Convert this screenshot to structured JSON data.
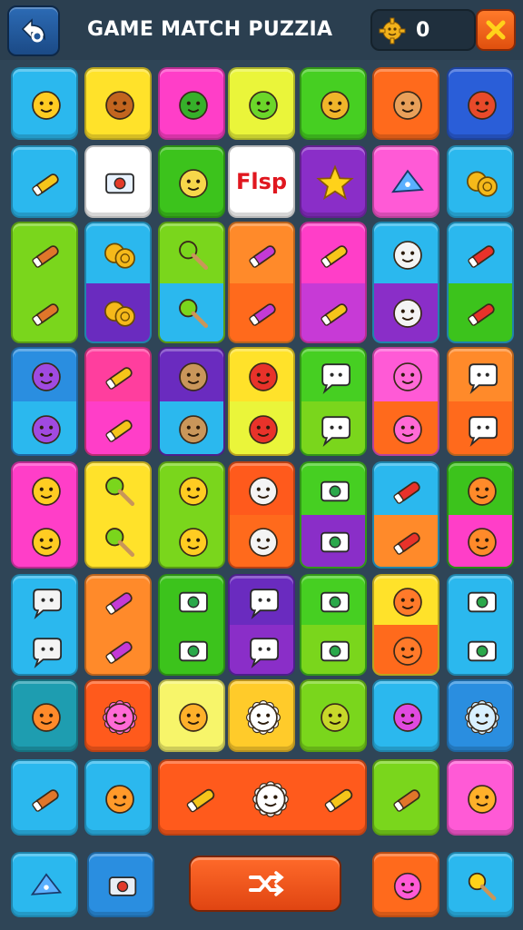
{
  "header": {
    "back_icon": "back-arrow-icon",
    "title": "GAME MATCH PUZZIA",
    "score_icon": "gold-gear-coin-icon",
    "score": "0",
    "close_icon": "close-icon"
  },
  "board": {
    "rows": [
      [
        {
          "name": "smiley-face",
          "color": "#2bb8ee",
          "icon": "smiley-face-icon"
        },
        {
          "name": "brown-bear",
          "color": "#ffe22a",
          "icon": "brown-bear-icon"
        },
        {
          "name": "green-leaf",
          "color": "#ff3ec8",
          "icon": "green-leaf-icon"
        },
        {
          "name": "green-blob",
          "color": "#eaf53a",
          "icon": "green-blob-icon"
        },
        {
          "name": "hamster",
          "color": "#46cf22",
          "icon": "hamster-icon"
        },
        {
          "name": "bread-bun",
          "color": "#ff6a1c",
          "icon": "bread-icon"
        },
        {
          "name": "sushi-roll",
          "color": "#2a5ed8",
          "icon": "sushi-icon"
        }
      ],
      [
        {
          "name": "marker",
          "color": "#2bb8ee",
          "icon": "marker-icon"
        },
        {
          "name": "photo-card",
          "color": "#ffffff",
          "icon": "photo-card-icon"
        },
        {
          "name": "giraffe",
          "color": "#3cc31c",
          "icon": "giraffe-icon"
        },
        {
          "name": "flsp-card",
          "color": "#ffffff",
          "icon": "word-card-icon",
          "word": "Flsp"
        },
        {
          "name": "star",
          "color": "#8a2ec8",
          "icon": "star-icon"
        },
        {
          "name": "cheese",
          "color": "#ff5ad6",
          "icon": "cheese-icon"
        },
        {
          "name": "coins",
          "color": "#2bb8ee",
          "icon": "coins-icon"
        }
      ],
      [
        {
          "name": "crayon-and-cylinder",
          "color": "#7ad61c",
          "lower": "#7ad61c",
          "icon": "crayon-icon"
        },
        {
          "name": "coins-and-cross",
          "color": "#2bb8ee",
          "lower": "#6a2bbf",
          "icon": "coins-icon"
        },
        {
          "name": "lollipop-and-bird",
          "color": "#7ad61c",
          "lower": "#2bb8ee",
          "icon": "lollipop-icon"
        },
        {
          "name": "pen-and-torch",
          "color": "#ff8a2a",
          "lower": "#ff6a1c",
          "icon": "pen-icon"
        },
        {
          "name": "marker-and-ghost",
          "color": "#ff3ec8",
          "lower": "#c73ad6",
          "icon": "marker-icon"
        },
        {
          "name": "cat-and-crossbones",
          "color": "#2bb8ee",
          "lower": "#8a2ec8",
          "icon": "cat-face-icon"
        },
        {
          "name": "sausage-and-swirl",
          "color": "#2bb8ee",
          "lower": "#3cc31c",
          "icon": "sausage-icon"
        }
      ],
      [
        {
          "name": "purple-blob-and-cat",
          "color": "#2a8ee0",
          "lower": "#2bb8ee",
          "icon": "purple-blob-icon"
        },
        {
          "name": "hammer-and-virus",
          "color": "#ff3e9e",
          "lower": "#ff3ec8",
          "icon": "hammer-icon"
        },
        {
          "name": "toast-and-sausage",
          "color": "#6a2bbf",
          "lower": "#2bb8ee",
          "icon": "toast-icon"
        },
        {
          "name": "berry-and-banana",
          "color": "#ffe22a",
          "lower": "#eaf53a",
          "icon": "berry-icon"
        },
        {
          "name": "speech-and-key",
          "color": "#46cf22",
          "lower": "#7ad61c",
          "icon": "speech-bubble-icon"
        },
        {
          "name": "pink-blob-and-jar",
          "color": "#ff5ad6",
          "lower": "#ff6a1c",
          "icon": "pink-blob-icon"
        },
        {
          "name": "bubble-and-strawberry",
          "color": "#ff8a2a",
          "lower": "#ff6a1c",
          "icon": "speech-bubble-icon"
        }
      ],
      [
        {
          "name": "bird-and-banana",
          "color": "#ff3ec8",
          "lower": "#ff3ec8",
          "icon": "bird-icon"
        },
        {
          "name": "lollipop-and-strawberry",
          "color": "#ffe22a",
          "lower": "#ffe22a",
          "icon": "lollipop-icon"
        },
        {
          "name": "smiley-and-blue-blob",
          "color": "#7ad61c",
          "lower": "#7ad61c",
          "icon": "smiley-face-icon"
        },
        {
          "name": "bat-and-blue-face",
          "color": "#ff5a1c",
          "lower": "#ff6a1c",
          "icon": "bat-icon"
        },
        {
          "name": "camera-and-pink-face",
          "color": "#46cf22",
          "lower": "#8a2ec8",
          "icon": "camera-icon"
        },
        {
          "name": "sausage-and-cat",
          "color": "#2bb8ee",
          "lower": "#ff8a2a",
          "icon": "sausage-icon"
        },
        {
          "name": "fish-and-monkey",
          "color": "#3cc31c",
          "lower": "#ff3ec8",
          "icon": "fish-icon"
        }
      ],
      [
        {
          "name": "ghost-and-fish",
          "color": "#2bb8ee",
          "lower": "#2bb8ee",
          "icon": "ghost-icon"
        },
        {
          "name": "candy-and-strawberry",
          "color": "#ff8a2a",
          "lower": "#ff8a2a",
          "icon": "candy-icon"
        },
        {
          "name": "camera-and-checkbox",
          "color": "#3cc31c",
          "lower": "#3cc31c",
          "icon": "camera-icon"
        },
        {
          "name": "eyes-and-ghost",
          "color": "#6a2bbf",
          "lower": "#8a2ec8",
          "icon": "eyes-icon"
        },
        {
          "name": "camera-and-rock",
          "color": "#46cf22",
          "lower": "#7ad61c",
          "icon": "camera-icon"
        },
        {
          "name": "horn-and-pink-face",
          "color": "#ffe22a",
          "lower": "#ff6a1c",
          "icon": "horn-icon"
        },
        {
          "name": "camera-and-fish",
          "color": "#2bb8ee",
          "lower": "#2bb8ee",
          "icon": "camera-icon"
        }
      ],
      [
        {
          "name": "fish-face",
          "color": "#1e9db0",
          "icon": "fish-face-icon"
        },
        {
          "name": "sun-flower",
          "color": "#ff5a1c",
          "icon": "sun-flower-icon"
        },
        {
          "name": "orange-blob",
          "color": "#f7f56a",
          "icon": "orange-blob-icon"
        },
        {
          "name": "sun-face",
          "color": "#ffcb2a",
          "icon": "sun-face-icon"
        },
        {
          "name": "pear",
          "color": "#7ad61c",
          "icon": "pear-icon"
        },
        {
          "name": "pink-dragon",
          "color": "#2bb8ee",
          "icon": "pink-dragon-icon"
        },
        {
          "name": "snowflake-face",
          "color": "#2a8ee0",
          "icon": "snowflake-face-icon"
        }
      ],
      [
        {
          "name": "purple-crayon",
          "color": "#2bb8ee",
          "icon": "crayon-icon"
        },
        {
          "name": "orange-monster",
          "color": "#2bb8ee",
          "icon": "orange-monster-icon"
        },
        {
          "name": "power-tile",
          "color": "#ff5a1c",
          "icon": "power-tile-icon",
          "wide": true
        },
        {
          "name": "purple-crayon-2",
          "color": "#7ad61c",
          "icon": "crayon-icon"
        },
        {
          "name": "lion",
          "color": "#ff5ad6",
          "icon": "lion-icon"
        }
      ]
    ]
  },
  "bottom_bar": {
    "left_items": [
      {
        "name": "cheese-block",
        "color": "#2bb8ee",
        "icon": "cheese-icon"
      },
      {
        "name": "device",
        "color": "#2a8ee0",
        "icon": "device-icon"
      }
    ],
    "center_button_icon": "shuffle-icon",
    "right_items": [
      {
        "name": "alarm-clock",
        "color": "#ff6a1c",
        "icon": "alarm-clock-icon"
      },
      {
        "name": "key",
        "color": "#2bb8ee",
        "icon": "key-icon"
      }
    ]
  }
}
